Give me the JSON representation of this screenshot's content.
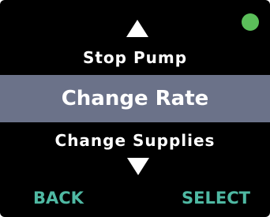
{
  "device": {
    "status_indicator": {
      "icon": "status-dot-icon",
      "color": "#5bbf5a"
    }
  },
  "menu": {
    "scroll_up_icon": "triangle-up-icon",
    "scroll_down_icon": "triangle-down-icon",
    "item_above": "Stop Pump",
    "item_selected": "Change Rate",
    "item_below": "Change Supplies",
    "selected_highlight_color": "#6b7289"
  },
  "softkeys": {
    "left_label": "BACK",
    "right_label": "SELECT",
    "color": "#4fb9a3"
  }
}
